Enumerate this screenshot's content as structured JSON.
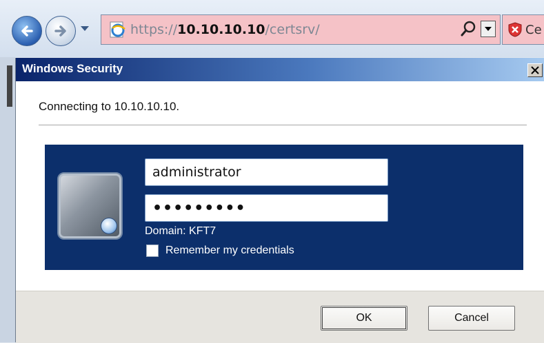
{
  "browser": {
    "address_url_prefix": "https://",
    "address_url_host": "10.10.10.10",
    "address_url_path": "/certsrv/",
    "cert_tab_text": "Ce",
    "icons": {
      "back": "back-arrow-icon",
      "forward": "forward-arrow-icon",
      "site": "ie-page-icon",
      "search": "search-icon",
      "cert_error": "cert-error-shield-icon"
    },
    "colors": {
      "address_error_bg": "#f5c2c7"
    }
  },
  "dialog": {
    "title": "Windows Security",
    "connecting_text": "Connecting to 10.10.10.10.",
    "username_value": "administrator",
    "password_masked": "•••••••••",
    "domain_text": "Domain: KFT7",
    "remember_label": "Remember my credentials",
    "remember_checked": false,
    "ok_label": "OK",
    "cancel_label": "Cancel",
    "colors": {
      "tile_bg": "#0c2f6b",
      "title_bar": "#0a246a"
    }
  }
}
